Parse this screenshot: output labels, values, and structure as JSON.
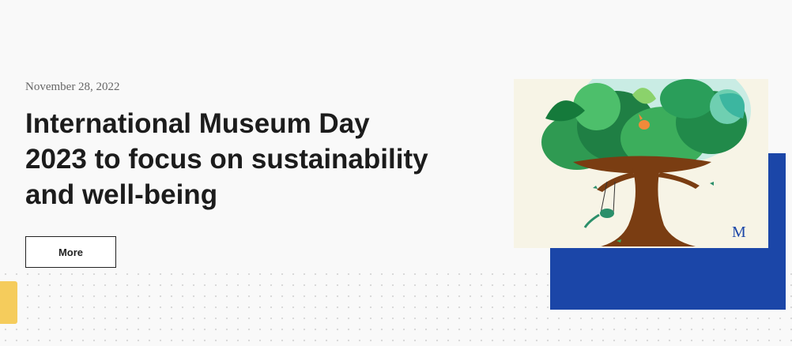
{
  "article": {
    "date": "November 28, 2022",
    "title_lines": [
      "International Museum Day",
      "2023 to focus on sustainability",
      "and well-being"
    ],
    "more_label": "More"
  },
  "artwork": {
    "description_icon": "tree-illustration",
    "logo_letters": "M"
  },
  "colors": {
    "background": "#f9f9f9",
    "accent_blue": "#1b46a8",
    "accent_yellow": "#f5cc5c",
    "title_text": "#1c1c1c",
    "art_background": "#f7f4e6",
    "tree_trunk": "#7a3d12"
  }
}
